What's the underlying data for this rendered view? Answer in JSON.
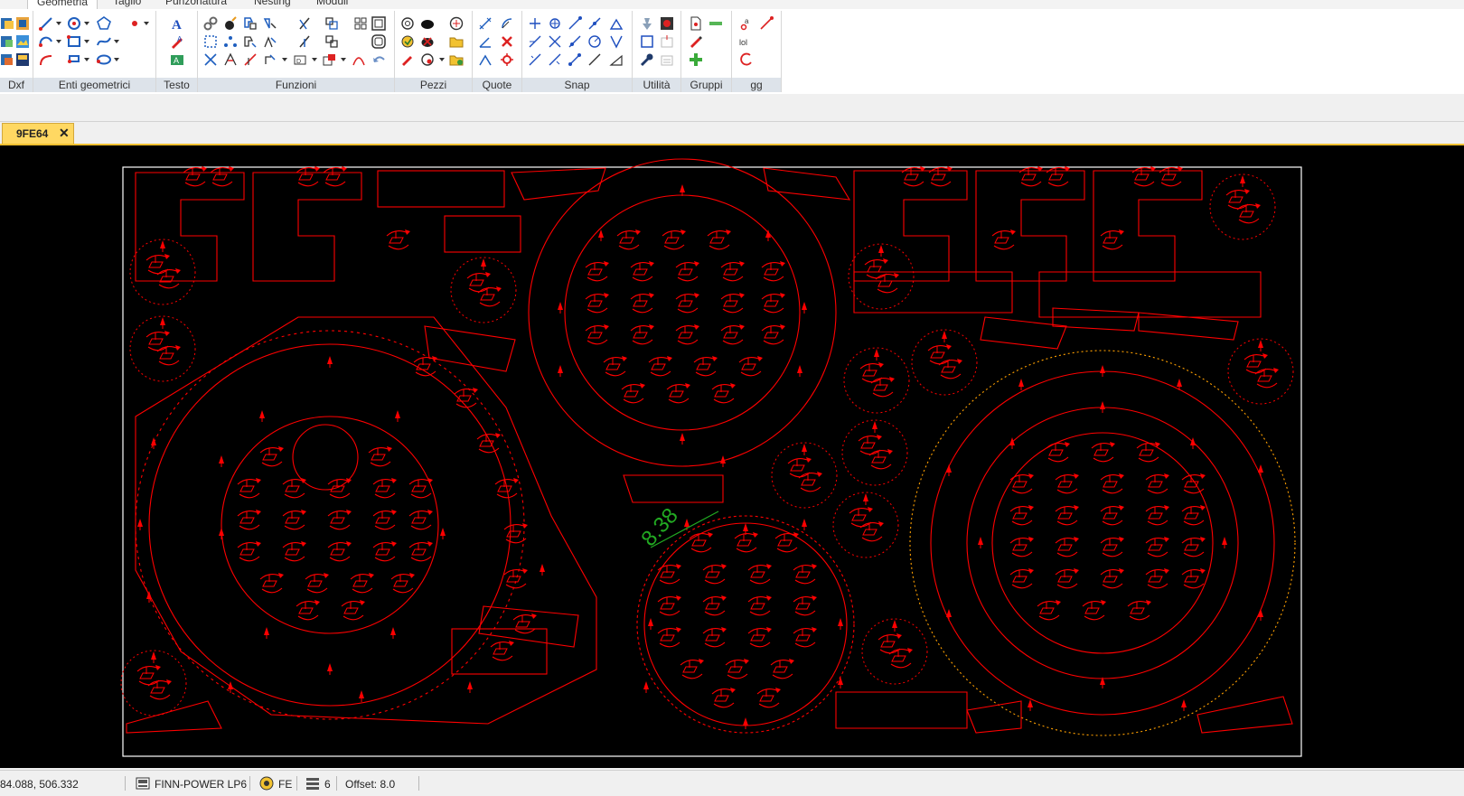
{
  "menu": {
    "tabs": [
      {
        "label": "Geometria"
      },
      {
        "label": "Taglio"
      },
      {
        "label": "Punzonatura"
      },
      {
        "label": "Nesting"
      },
      {
        "label": "Moduli"
      }
    ]
  },
  "ribbon": {
    "groups": [
      {
        "label": "Dxf"
      },
      {
        "label": "Enti geometrici"
      },
      {
        "label": "Testo"
      },
      {
        "label": "Funzioni"
      },
      {
        "label": "Pezzi"
      },
      {
        "label": "Quote"
      },
      {
        "label": "Snap"
      },
      {
        "label": "Utilità"
      },
      {
        "label": "Gruppi"
      },
      {
        "label": "gg"
      }
    ]
  },
  "document_tab": {
    "title": "9FE64",
    "close": "✕"
  },
  "canvas": {
    "background": "#000000",
    "part_color": "#ff0000",
    "sheet_border_color": "#ffffff",
    "dimension_color": "#22aa22",
    "dimension_label": "8.38"
  },
  "status": {
    "coordinates": "84.088, 506.332",
    "machine": "FINN-POWER LP6",
    "mode": "FE",
    "layers": "6",
    "offset": "Offset: 8.0"
  }
}
